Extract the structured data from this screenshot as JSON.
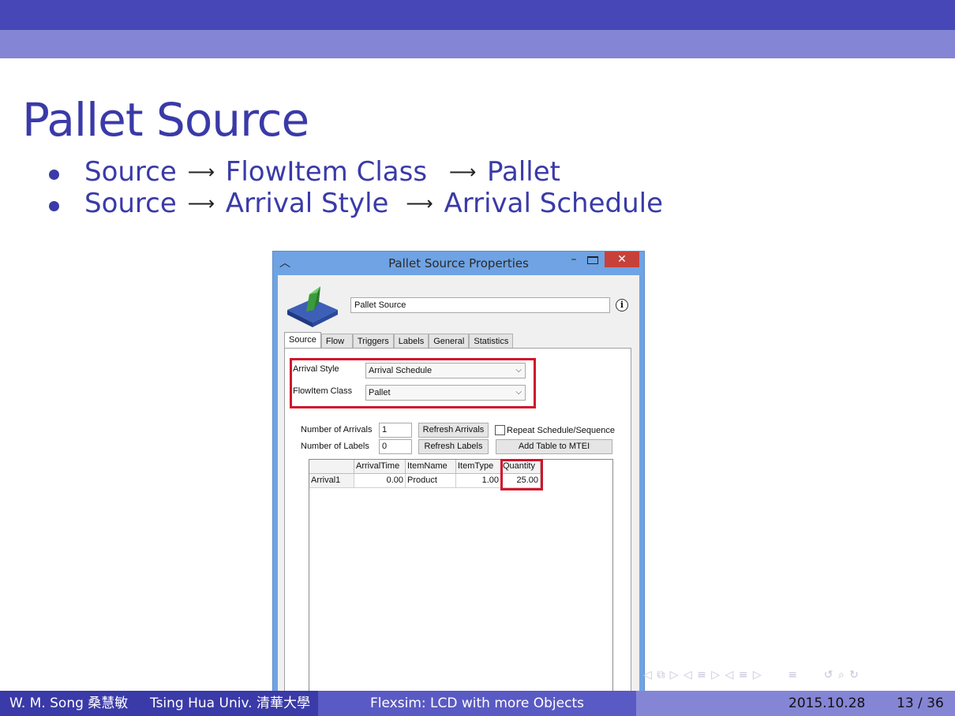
{
  "slide": {
    "title": "Pallet Source",
    "bullets": [
      {
        "parts": [
          "Source",
          "FlowItem Class",
          "Pallet"
        ]
      },
      {
        "parts": [
          "Source",
          "Arrival Style",
          "Arrival Schedule"
        ]
      }
    ]
  },
  "window": {
    "title": "Pallet Source  Properties",
    "object_name": "Pallet Source",
    "tabs": [
      "Source",
      "Flow",
      "Triggers",
      "Labels",
      "General",
      "Statistics"
    ],
    "active_tab": "Source",
    "arrival_style_label": "Arrival Style",
    "arrival_style_value": "Arrival Schedule",
    "flowitem_class_label": "FlowItem Class",
    "flowitem_class_value": "Pallet",
    "num_arrivals_label": "Number of Arrivals",
    "num_arrivals_value": "1",
    "num_labels_label": "Number of Labels",
    "num_labels_value": "0",
    "refresh_arrivals": "Refresh Arrivals",
    "refresh_labels": "Refresh Labels",
    "repeat_label": "Repeat Schedule/Sequence",
    "add_table": "Add Table to MTEI",
    "table": {
      "headers": [
        "",
        "ArrivalTime",
        "ItemName",
        "ItemType",
        "Quantity"
      ],
      "rows": [
        [
          "Arrival1",
          "0.00",
          "Product",
          "1.00",
          "25.00"
        ]
      ]
    },
    "highlight_color": "#d0142b"
  },
  "footer": {
    "author": "W. M. Song 桑慧敏",
    "institution": "Tsing Hua Univ. 清華大學",
    "course": "Flexsim: LCD with more Objects",
    "date": "2015.10.28",
    "page": "13 / 36"
  },
  "colors": {
    "theme_dark": "#3a3aa8",
    "theme_light": "#8585d6"
  }
}
